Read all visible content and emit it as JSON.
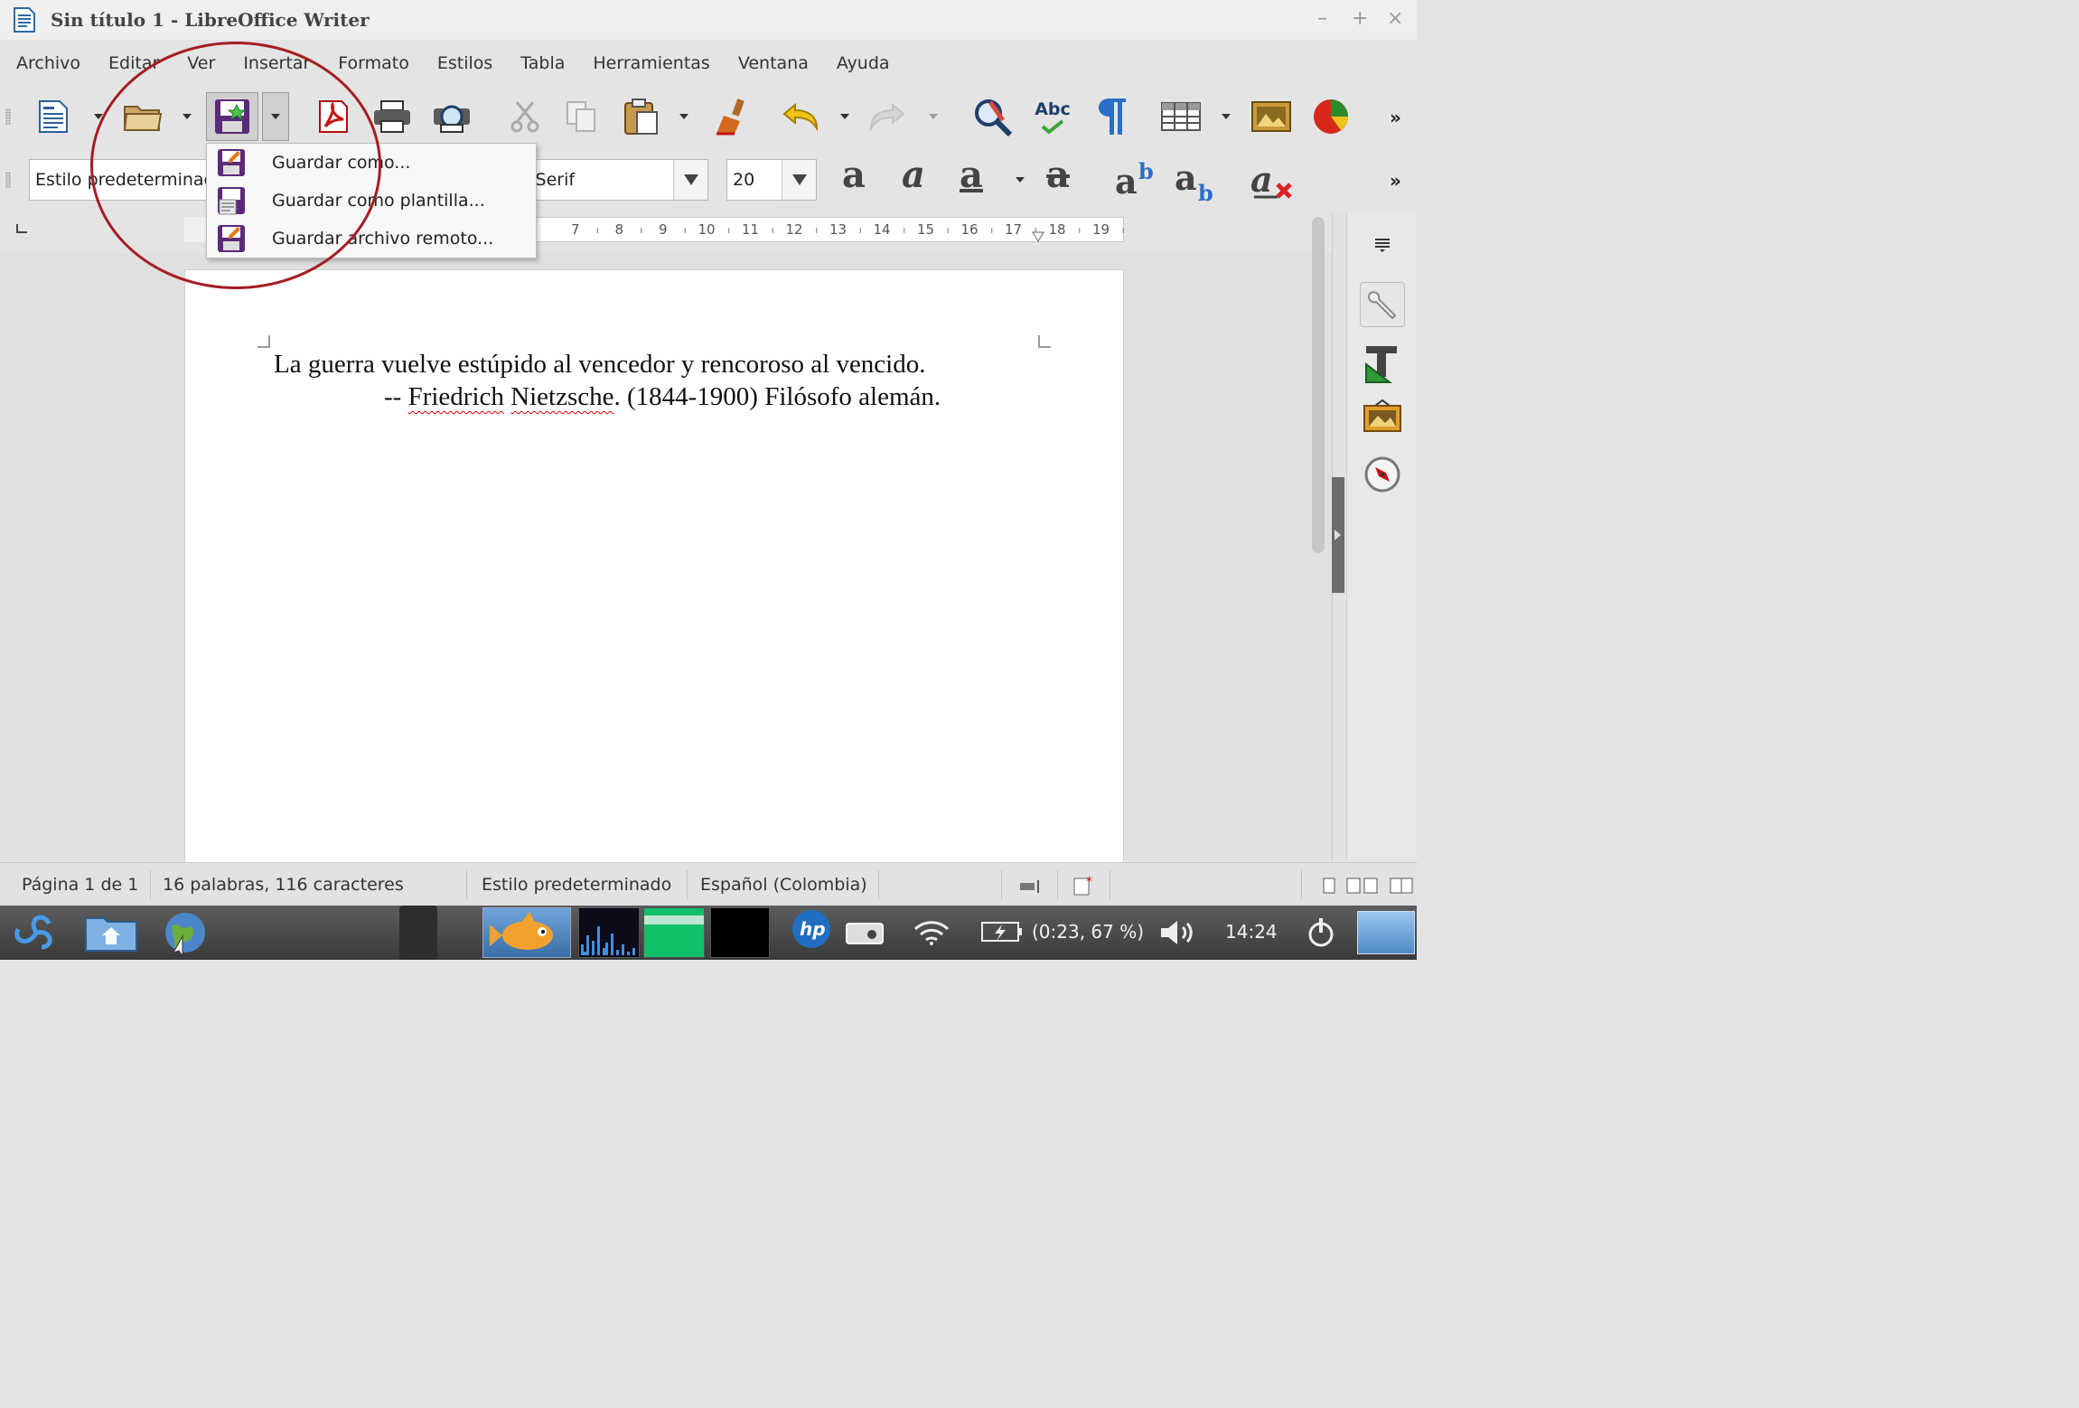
{
  "window": {
    "title": "Sin título 1 - LibreOffice Writer",
    "controls": [
      "–",
      "+",
      "×"
    ]
  },
  "menubar": [
    "Archivo",
    "Editar",
    "Ver",
    "Insertar",
    "Formato",
    "Estilos",
    "Tabla",
    "Herramientas",
    "Ventana",
    "Ayuda"
  ],
  "toolbar": {
    "icons": [
      "new-document-icon",
      "open-folder-icon",
      "save-icon",
      "export-pdf-icon",
      "print-icon",
      "print-preview-icon",
      "cut-icon",
      "copy-icon",
      "paste-icon",
      "clone-formatting-icon",
      "undo-icon",
      "redo-icon",
      "find-replace-icon",
      "spellcheck-icon",
      "formatting-marks-icon",
      "insert-table-icon",
      "insert-image-icon",
      "insert-chart-icon"
    ],
    "spellcheck_label": "Abc",
    "overflow": "»"
  },
  "formatting": {
    "paragraph_style": "Estilo predeterminado",
    "font_name": "Liberation Serif",
    "font_size": "20",
    "overflow": "»"
  },
  "save_menu": {
    "items": [
      "Guardar como...",
      "Guardar como plantilla...",
      "Guardar archivo remoto..."
    ]
  },
  "ruler": {
    "numbers": [
      "7",
      "8",
      "9",
      "10",
      "11",
      "12",
      "13",
      "14",
      "15",
      "16",
      "17",
      "18",
      "19"
    ]
  },
  "document": {
    "line1": "La guerra vuelve estúpido al vencedor y rencoroso al vencido.",
    "line2_prefix": "-- ",
    "line2_name1": "Friedrich",
    "line2_name2": "Nietzsche",
    "line2_rest": ". (1844-1900) Filósofo alemán."
  },
  "statusbar": {
    "page": "Página 1 de 1",
    "words": "16 palabras, 116 caracteres",
    "style": "Estilo predeterminado",
    "language": "Español (Colombia)"
  },
  "taskbar": {
    "battery": "(0:23, 67 %)",
    "clock": "14:24"
  },
  "colors": {
    "annotation": "#a41d22",
    "spell_underline": "#dd0000",
    "taskbar": "#3a3a3a"
  }
}
